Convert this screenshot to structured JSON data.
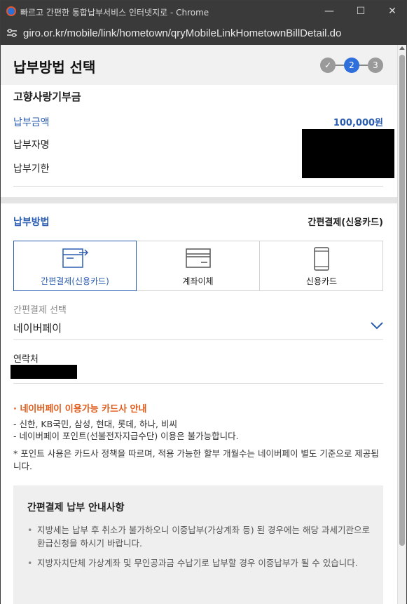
{
  "browser": {
    "window_title": "빠르고 간편한 통합납부서비스 인터넷지로 - Chrome",
    "url": "giro.or.kr/mobile/link/hometown/qryMobileLinkHometownBillDetail.do",
    "minimize_glyph": "—",
    "maximize_glyph": "☐",
    "close_glyph": "✕"
  },
  "header": {
    "title": "납부방법 선택",
    "steps": [
      {
        "label": "✓",
        "state": "done",
        "color": "#9a9a9a"
      },
      {
        "label": "2",
        "state": "current",
        "color": "#2f6fdc"
      },
      {
        "label": "3",
        "state": "upcoming",
        "color": "#9a9a9a"
      }
    ]
  },
  "bill": {
    "name": "고향사랑기부금",
    "amount_label": "납부금액",
    "amount_value": "100,000원",
    "payer_label": "납부자명",
    "due_label": "납부기한"
  },
  "payment_method": {
    "label": "납부방법",
    "selected_value": "간편결제(신용카드)",
    "tabs": [
      {
        "label": "간편결제(신용카드)",
        "icon": "easy-pay-card-icon",
        "active": true
      },
      {
        "label": "계좌이체",
        "icon": "bank-transfer-icon",
        "active": false
      },
      {
        "label": "신용카드",
        "icon": "mobile-card-icon",
        "active": false
      }
    ]
  },
  "easy_pay": {
    "select_label": "간편결제 선택",
    "select_value": "네이버페이",
    "contact_label": "연락처"
  },
  "notice": {
    "title": "· 네이버페이 이용가능 카드사 안내",
    "lines": [
      "- 신한, KB국민, 삼성, 현대, 롯데, 하나, 비씨",
      "- 네이버페이 포인트(선불전자지급수단) 이용은 불가능합니다."
    ],
    "footnote": "* 포인트 사용은 카드사 정책을 따르며, 적용 가능한 할부 개월수는 네이버페이 별도 기준으로 제공됩니다."
  },
  "guide": {
    "title": "간편결제 납부 안내사항",
    "items": [
      "지방세는 납부 후 취소가 불가하오니 이중납부(가상계좌 등) 된 경우에는 해당 과세기관으로 환급신청을 하시기 바랍니다.",
      "지방자치단체 가상계좌 및 무인공과금 수납기로 납부할 경우 이중납부가 될 수 있습니다."
    ]
  },
  "colors": {
    "accent_blue": "#2a5db0",
    "step_active": "#2f6fdc",
    "notice_orange": "#e05a1a"
  }
}
